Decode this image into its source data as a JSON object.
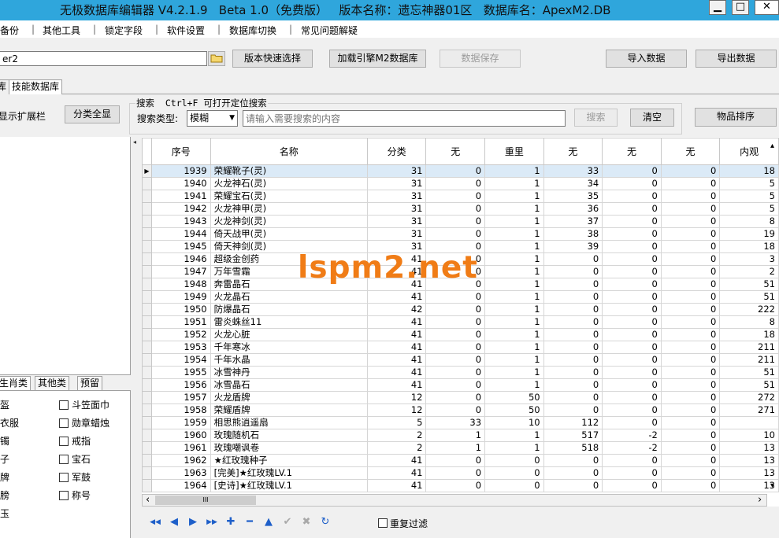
{
  "window": {
    "title": "无极数据库编辑器 V4.2.1.9   Beta 1.0（免费版）   版本名称：遗忘神器01区   数据库名：ApexM2.DB",
    "minimize_glyph": "▁",
    "maximize_glyph": "□",
    "close_glyph": "✕"
  },
  "menu": [
    "备份",
    "其他工具",
    "锁定字段",
    "软件设置",
    "数据库切换",
    "常见问题解疑"
  ],
  "toolbar": {
    "path_value": "er2",
    "folder_icon": "folder-icon",
    "version_select": "版本快速选择",
    "load_engine": "加载引擎M2数据库",
    "save_data": "数据保存",
    "import_data": "导入数据",
    "export_data": "导出数据"
  },
  "tabs": [
    "库",
    "技能数据库"
  ],
  "search": {
    "show_extend": "显示扩展栏",
    "all_categories": "分类全显",
    "hint": "搜索  Ctrl+F 可打开定位搜索",
    "type_label": "搜索类型:",
    "type_value": "模糊",
    "placeholder": "请输入需要搜索的内容",
    "search_button": "搜索",
    "clear_button": "清空",
    "sort_button": "物品排序"
  },
  "left_tabs": [
    "生肖类",
    "其他类",
    "预留"
  ],
  "left_checks": [
    {
      "left": "盔",
      "right": "斗笠面巾"
    },
    {
      "left": "衣服",
      "right": "勋章蜡烛"
    },
    {
      "left": "镯",
      "right": "戒指"
    },
    {
      "left": "子",
      "right": "宝石"
    },
    {
      "left": "牌",
      "right": "军鼓"
    },
    {
      "left": "膀",
      "right": "称号"
    },
    {
      "left": "玉",
      "right": ""
    }
  ],
  "grid": {
    "columns": [
      "序号",
      "名称",
      "分类",
      "无",
      "重里",
      "无",
      "无",
      "无",
      "内观"
    ],
    "rows": [
      [
        "1939",
        "荣耀靴子(灵)",
        "31",
        "0",
        "1",
        "33",
        "0",
        "0",
        "18"
      ],
      [
        "1940",
        "火龙神石(灵)",
        "31",
        "0",
        "1",
        "34",
        "0",
        "0",
        "5"
      ],
      [
        "1941",
        "荣耀宝石(灵)",
        "31",
        "0",
        "1",
        "35",
        "0",
        "0",
        "5"
      ],
      [
        "1942",
        "火龙神甲(灵)",
        "31",
        "0",
        "1",
        "36",
        "0",
        "0",
        "5"
      ],
      [
        "1943",
        "火龙神剑(灵)",
        "31",
        "0",
        "1",
        "37",
        "0",
        "0",
        "8"
      ],
      [
        "1944",
        "倚天战甲(灵)",
        "31",
        "0",
        "1",
        "38",
        "0",
        "0",
        "19"
      ],
      [
        "1945",
        "倚天神剑(灵)",
        "31",
        "0",
        "1",
        "39",
        "0",
        "0",
        "18"
      ],
      [
        "1946",
        "超级金创药",
        "41",
        "0",
        "1",
        "0",
        "0",
        "0",
        "3"
      ],
      [
        "1947",
        "万年雪霜",
        "41",
        "0",
        "1",
        "0",
        "0",
        "0",
        "2"
      ],
      [
        "1948",
        "奔雷晶石",
        "41",
        "0",
        "1",
        "0",
        "0",
        "0",
        "51"
      ],
      [
        "1949",
        "火龙晶石",
        "41",
        "0",
        "1",
        "0",
        "0",
        "0",
        "51"
      ],
      [
        "1950",
        "防爆晶石",
        "42",
        "0",
        "1",
        "0",
        "0",
        "0",
        "222"
      ],
      [
        "1951",
        "雷炎蛛丝11",
        "41",
        "0",
        "1",
        "0",
        "0",
        "0",
        "8"
      ],
      [
        "1952",
        "火龙心脏",
        "41",
        "0",
        "1",
        "0",
        "0",
        "0",
        "18"
      ],
      [
        "1953",
        "千年寒冰",
        "41",
        "0",
        "1",
        "0",
        "0",
        "0",
        "211"
      ],
      [
        "1954",
        "千年水晶",
        "41",
        "0",
        "1",
        "0",
        "0",
        "0",
        "211"
      ],
      [
        "1955",
        "冰雪神丹",
        "41",
        "0",
        "1",
        "0",
        "0",
        "0",
        "51"
      ],
      [
        "1956",
        "冰雪晶石",
        "41",
        "0",
        "1",
        "0",
        "0",
        "0",
        "51"
      ],
      [
        "1957",
        "火龙盾牌",
        "12",
        "0",
        "50",
        "0",
        "0",
        "0",
        "272"
      ],
      [
        "1958",
        "荣耀盾牌",
        "12",
        "0",
        "50",
        "0",
        "0",
        "0",
        "271"
      ],
      [
        "1959",
        "相思熊逍遥扇",
        "5",
        "33",
        "10",
        "112",
        "0",
        "0",
        ""
      ],
      [
        "1960",
        "玫瑰随机石",
        "2",
        "1",
        "1",
        "517",
        "-2",
        "0",
        "10"
      ],
      [
        "1961",
        "玫瑰嘲讽卷",
        "2",
        "1",
        "1",
        "518",
        "-2",
        "0",
        "13"
      ],
      [
        "1962",
        "★红玫瑰种子",
        "41",
        "0",
        "0",
        "0",
        "0",
        "0",
        "13"
      ],
      [
        "1963",
        "[完美]★红玫瑰LV.1",
        "41",
        "0",
        "0",
        "0",
        "0",
        "0",
        "13"
      ],
      [
        "1964",
        "[史诗]★红玫瑰LV.1",
        "41",
        "0",
        "0",
        "0",
        "0",
        "0",
        "13"
      ]
    ],
    "selected_row": 0
  },
  "scroll": {
    "left_arrow": "‹",
    "right_arrow": "›",
    "thumb_grip": "III",
    "up_arrow": "▴",
    "down_arrow": "▾"
  },
  "navigator": [
    {
      "name": "first-record-icon",
      "glyph": "◀◀"
    },
    {
      "name": "prior-record-icon",
      "glyph": "◀"
    },
    {
      "name": "next-record-icon",
      "glyph": "▶"
    },
    {
      "name": "last-record-icon",
      "glyph": "▶▶"
    },
    {
      "name": "insert-record-icon",
      "glyph": "✚"
    },
    {
      "name": "delete-record-icon",
      "glyph": "━"
    },
    {
      "name": "edit-record-icon",
      "glyph": "▲"
    },
    {
      "name": "post-edit-icon",
      "glyph": "✔"
    },
    {
      "name": "cancel-edit-icon",
      "glyph": "✖"
    },
    {
      "name": "refresh-data-icon",
      "glyph": "↻"
    }
  ],
  "dedup_filter": "重复过滤",
  "watermark": "lspm2.net",
  "colors": {
    "titlebar": "#2fa6dc",
    "watermark": "#f07c16",
    "selected_row": "#dbeaf7"
  }
}
